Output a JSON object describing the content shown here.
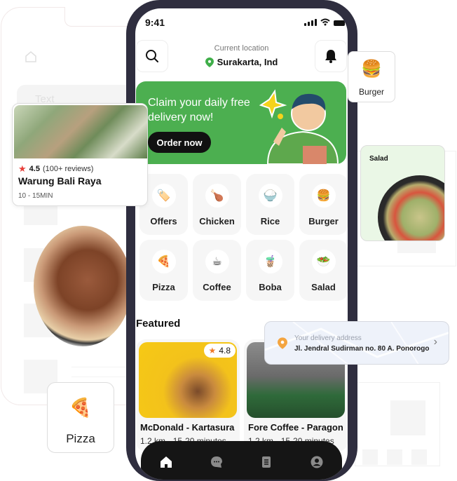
{
  "background": {
    "ghost_search_placeholder": "Text"
  },
  "status_bar": {
    "time": "9:41"
  },
  "header": {
    "location_label": "Current location",
    "location_value": "Surakarta, Ind",
    "search_icon": "search-icon",
    "notification_icon": "bell-icon"
  },
  "banner": {
    "title": "Claim your daily free delivery now!",
    "button_label": "Order now",
    "bg_color": "#4caf50"
  },
  "categories": [
    {
      "label": "Offers",
      "icon": "🏷️"
    },
    {
      "label": "Chicken",
      "icon": "🍗"
    },
    {
      "label": "Rice",
      "icon": "🍚"
    },
    {
      "label": "Burger",
      "icon": "🍔"
    },
    {
      "label": "Pizza",
      "icon": "🍕"
    },
    {
      "label": "Coffee",
      "icon": "☕"
    },
    {
      "label": "Boba",
      "icon": "🧋"
    },
    {
      "label": "Salad",
      "icon": "🥗"
    }
  ],
  "featured": {
    "title": "Featured",
    "items": [
      {
        "name": "McDonald - Kartasura",
        "distance": "1.2 km",
        "time": "15-20 minutes",
        "rating": "4.8"
      },
      {
        "name": "Fore Coffee - Paragon",
        "distance": "1.2 km",
        "time": "15-20 minutes"
      }
    ]
  },
  "bottom_nav": [
    {
      "name": "home",
      "icon": "home-icon",
      "active": true
    },
    {
      "name": "chat",
      "icon": "chat-icon",
      "active": false
    },
    {
      "name": "orders",
      "icon": "orders-icon",
      "active": false
    },
    {
      "name": "profile",
      "icon": "profile-icon",
      "active": false
    }
  ],
  "floating": {
    "restaurant": {
      "rating": "4.5",
      "reviews": "(100+ reviews)",
      "name": "Warung Bali Raya",
      "time": "10 - 15MIN"
    },
    "pizza_card": {
      "emoji": "🍕",
      "label": "Pizza"
    },
    "burger_card": {
      "emoji": "🍔",
      "label": "Burger"
    },
    "salad_card": {
      "label": "Salad"
    },
    "address": {
      "label": "Your delivery address",
      "value": "Jl. Jendral Sudirman no. 80 A. Ponorogo"
    }
  }
}
